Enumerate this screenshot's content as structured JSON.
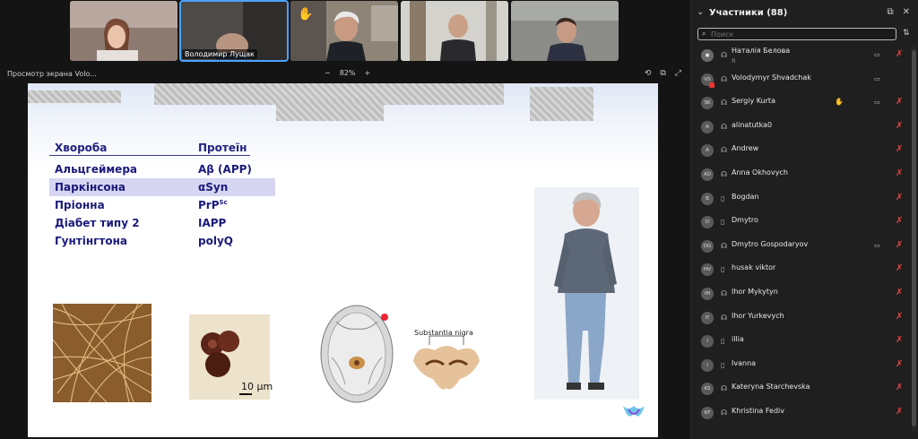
{
  "video_tiles": [
    {
      "name": "",
      "hand": false,
      "active": false,
      "bg": "#6b4a42"
    },
    {
      "name": "Володимир Лущак",
      "hand": false,
      "active": true,
      "bg": "#5d5a55"
    },
    {
      "name": "",
      "hand": true,
      "active": false,
      "bg": "#7a7068"
    },
    {
      "name": "",
      "hand": false,
      "active": false,
      "bg": "#6e6a63"
    },
    {
      "name": "",
      "hand": false,
      "active": false,
      "bg": "#5a5c60"
    }
  ],
  "share_bar": {
    "title": "Просмотр экрана Volo...",
    "zoom_minus": "−",
    "zoom_level": "82%",
    "zoom_plus": "+"
  },
  "slide": {
    "table": {
      "header": {
        "disease": "Хвороба",
        "protein": "Протеїн"
      },
      "rows": [
        {
          "disease": "Альцгеймера",
          "protein": "Aβ (APP)",
          "sup": ""
        },
        {
          "disease": "Паркінсона",
          "protein": "αSyn",
          "sup": ""
        },
        {
          "disease": "Пріонна",
          "protein": "PrP",
          "sup": "Sc"
        },
        {
          "disease": "Діабет типу 2",
          "protein": "IAPP",
          "sup": ""
        },
        {
          "disease": "Гунтінгтона",
          "protein": "polyQ",
          "sup": ""
        }
      ]
    },
    "scale_label": "10 μm",
    "nigra_label": "Substantia nigra"
  },
  "panel": {
    "title": "Участники (88)",
    "search_placeholder": "Поиск",
    "participants": [
      {
        "initials": "",
        "name": "Наталія Белова",
        "sub": "Я",
        "device": "mic",
        "hand": false,
        "cam": true,
        "muted": true
      },
      {
        "initials": "VS",
        "name": "Volodymyr Shvadchak",
        "sub": "",
        "device": "headset",
        "hand": false,
        "cam": true,
        "muted": false,
        "badge": true
      },
      {
        "initials": "SK",
        "name": "Sergiy Kurta",
        "sub": "",
        "device": "headset",
        "hand": true,
        "cam": true,
        "muted": true
      },
      {
        "initials": "A",
        "name": "alinatutka0",
        "sub": "",
        "device": "headset",
        "hand": false,
        "cam": false,
        "muted": true
      },
      {
        "initials": "A",
        "name": "Andrew",
        "sub": "",
        "device": "headset",
        "hand": false,
        "cam": false,
        "muted": true
      },
      {
        "initials": "AO",
        "name": "Anna Okhovych",
        "sub": "",
        "device": "headset",
        "hand": false,
        "cam": false,
        "muted": true
      },
      {
        "initials": "B",
        "name": "Bogdan",
        "sub": "",
        "device": "phone",
        "hand": false,
        "cam": false,
        "muted": true
      },
      {
        "initials": "D",
        "name": "Dmytro",
        "sub": "",
        "device": "phone",
        "hand": false,
        "cam": false,
        "muted": true
      },
      {
        "initials": "DG",
        "name": "Dmytro Gospodaryov",
        "sub": "",
        "device": "headset",
        "hand": false,
        "cam": true,
        "muted": true
      },
      {
        "initials": "HV",
        "name": "husak viktor",
        "sub": "",
        "device": "phone",
        "hand": false,
        "cam": false,
        "muted": true
      },
      {
        "initials": "IM",
        "name": "Ihor Mykytyn",
        "sub": "",
        "device": "headset",
        "hand": false,
        "cam": false,
        "muted": true
      },
      {
        "initials": "IY",
        "name": "Ihor Yurkevych",
        "sub": "",
        "device": "headset",
        "hand": false,
        "cam": false,
        "muted": true
      },
      {
        "initials": "I",
        "name": "illia",
        "sub": "",
        "device": "phone",
        "hand": false,
        "cam": false,
        "muted": true
      },
      {
        "initials": "I",
        "name": "Ivanna",
        "sub": "",
        "device": "phone",
        "hand": false,
        "cam": false,
        "muted": true
      },
      {
        "initials": "KS",
        "name": "Kateryna Starchevska",
        "sub": "",
        "device": "headset",
        "hand": false,
        "cam": false,
        "muted": true
      },
      {
        "initials": "KF",
        "name": "Khristina Fediv",
        "sub": "",
        "device": "headset",
        "hand": false,
        "cam": false,
        "muted": true
      }
    ]
  },
  "colors": {
    "mic_muted": "#e04545",
    "active_tile": "#4aa3ff",
    "slide_text": "#1a1a7a"
  }
}
